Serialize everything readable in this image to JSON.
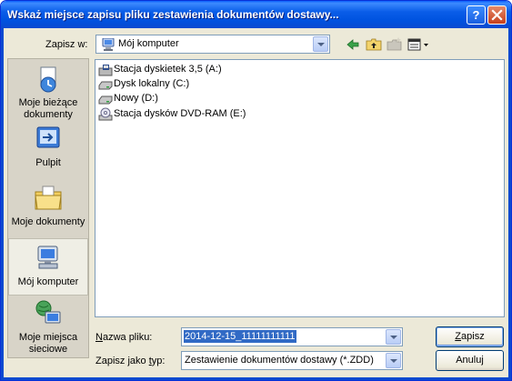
{
  "window": {
    "title": "Wskaż miejsce zapisu pliku zestawienia dokumentów dostawy...",
    "help_button": "?",
    "close_button": "✕"
  },
  "savein": {
    "label": "Zapisz w:",
    "value": "Mój komputer"
  },
  "toolbar": {
    "icons": [
      "back-icon",
      "up-folder-icon",
      "new-folder-icon",
      "view-menu-icon"
    ]
  },
  "places": [
    {
      "label": "Moje bieżące dokumenty",
      "icon": "recent-documents-icon"
    },
    {
      "label": "Pulpit",
      "icon": "desktop-icon"
    },
    {
      "label": "Moje dokumenty",
      "icon": "my-documents-icon"
    },
    {
      "label": "Mój komputer",
      "icon": "my-computer-icon",
      "active": true
    },
    {
      "label": "Moje miejsca sieciowe",
      "icon": "network-places-icon"
    }
  ],
  "files": [
    {
      "name": "Stacja dyskietek 3,5 (A:)",
      "icon": "floppy-drive-icon"
    },
    {
      "name": "Dysk lokalny (C:)",
      "icon": "hard-drive-icon"
    },
    {
      "name": "Nowy (D:)",
      "icon": "hard-drive-icon"
    },
    {
      "name": "Stacja dysków DVD-RAM (E:)",
      "icon": "dvd-drive-icon"
    }
  ],
  "filename": {
    "label": "Nazwa pliku:",
    "value": "2014-12-15_11111111111"
  },
  "filetype": {
    "label": "Zapisz jako typ:",
    "value": "Zestawienie dokumentów dostawy (*.ZDD)"
  },
  "buttons": {
    "save": "Zapisz",
    "cancel": "Anuluj"
  },
  "colors": {
    "titlebar": "#0a5de8",
    "dialog_bg": "#ece9d8",
    "selection": "#316ac5"
  }
}
